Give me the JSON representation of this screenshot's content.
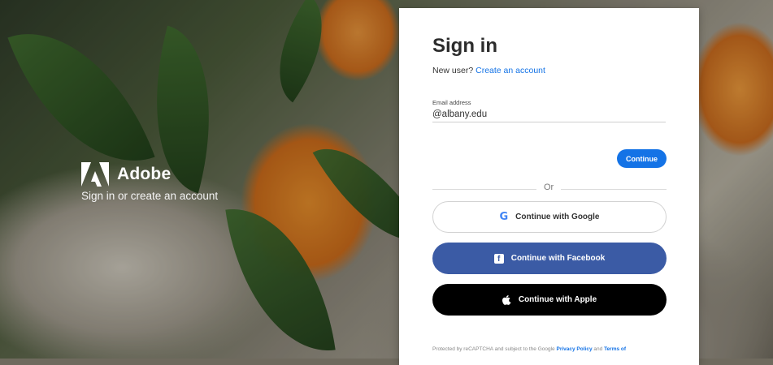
{
  "brand": {
    "name": "Adobe",
    "tagline": "Sign in or create an account",
    "logo_icon": "adobe-logo-icon"
  },
  "signin": {
    "title": "Sign in",
    "new_user_prompt": "New user?",
    "create_account_link": "Create an account",
    "email_label": "Email address",
    "email_value": "@albany.edu",
    "continue_label": "Continue",
    "or_label": "Or"
  },
  "social": {
    "google_label": "Continue with Google",
    "facebook_label": "Continue with Facebook",
    "apple_label": "Continue with Apple",
    "google_icon": "G"
  },
  "footer": {
    "text": "Protected by reCAPTCHA and subject to the Google",
    "privacy_link": "Privacy Policy",
    "and": "and",
    "terms_link": "Terms of"
  },
  "colors": {
    "accent": "#1473e6",
    "facebook": "#3b5ba5",
    "apple": "#000000"
  }
}
